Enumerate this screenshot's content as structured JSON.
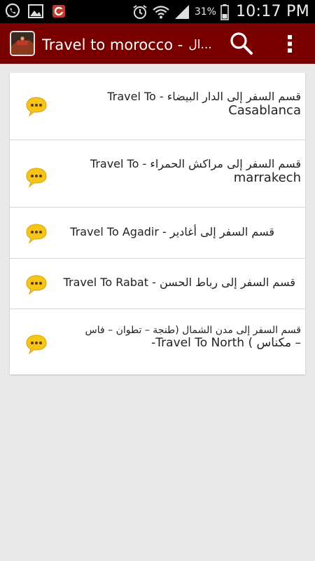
{
  "status_bar": {
    "battery_percent": "31%",
    "time": "10:17 PM",
    "notification_icons": [
      "whatsapp-icon",
      "gallery-icon",
      "security-shield-icon"
    ],
    "system_icons": [
      "alarm-icon",
      "wifi-icon",
      "signal-icon",
      "battery-icon"
    ]
  },
  "action_bar": {
    "title": "Travel to morocco -",
    "title_suffix": "ال...",
    "search_icon": "search-icon",
    "overflow_icon": "overflow-menu-icon",
    "bg_color": "#7a0000"
  },
  "list": {
    "items": [
      {
        "line1": "قسم السفر إلى الدار البيضاء - Travel To",
        "line2": "Casablanca",
        "icon": "chat-bubble-icon"
      },
      {
        "line1": "قسم السفر إلى مراكش الحمراء - Travel To",
        "line2": "marrakech",
        "icon": "chat-bubble-icon"
      },
      {
        "line1": "قسم السفر إلى أغادير - Travel To Agadir",
        "icon": "chat-bubble-icon"
      },
      {
        "line1": "قسم السفر إلى رباط الحسن - Travel To Rabat",
        "icon": "chat-bubble-icon"
      },
      {
        "line1": "قسم السفر إلى مدن الشمال (طنجة – تطوان – فاس",
        "line2": "– مكناس ) Travel To North-",
        "icon": "chat-bubble-icon"
      }
    ],
    "icon_color": "#f5c518"
  }
}
